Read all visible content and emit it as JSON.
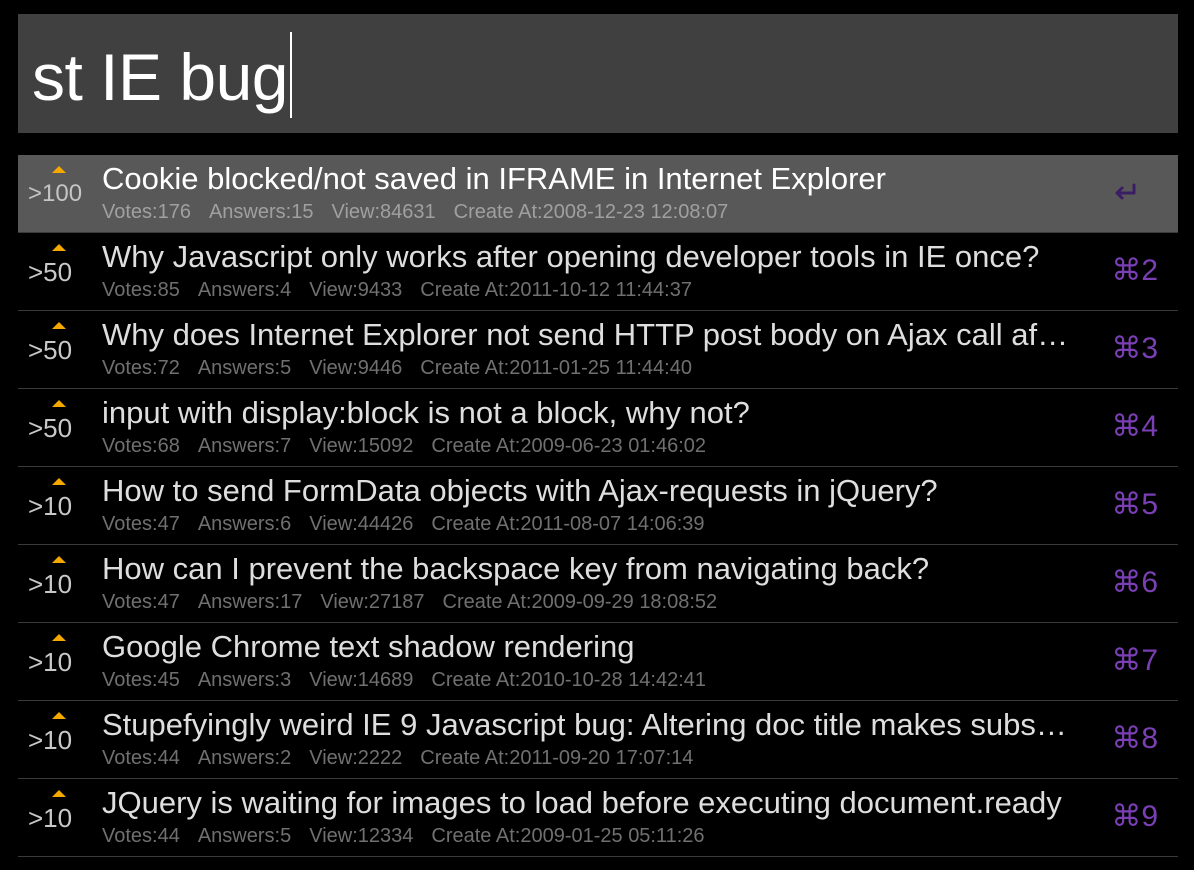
{
  "search": {
    "query": "st IE bug"
  },
  "colors": {
    "background": "#000000",
    "search_bg": "#404040",
    "selected_row_bg": "#585858",
    "shortcut_purple": "#7a3fb4",
    "score_arrow": "#f5a800"
  },
  "results": [
    {
      "score": ">100",
      "title": "Cookie blocked/not saved in IFRAME in Internet Explorer",
      "votes": "Votes:176",
      "answers": "Answers:15",
      "views": "View:84631",
      "created": "Create At:2008-12-23 12:08:07",
      "shortcut_icon": "return-icon",
      "selected": true
    },
    {
      "score": ">50",
      "title": "Why Javascript only works after opening developer tools in IE once?",
      "votes": "Votes:85",
      "answers": "Answers:4",
      "views": "View:9433",
      "created": "Create At:2011-10-12 11:44:37",
      "shortcut": "⌘2"
    },
    {
      "score": ">50",
      "title": "Why does Internet Explorer not send HTTP post body on Ajax call af…",
      "votes": "Votes:72",
      "answers": "Answers:5",
      "views": "View:9446",
      "created": "Create At:2011-01-25 11:44:40",
      "shortcut": "⌘3"
    },
    {
      "score": ">50",
      "title": "input with display:block is not a block, why not?",
      "votes": "Votes:68",
      "answers": "Answers:7",
      "views": "View:15092",
      "created": "Create At:2009-06-23 01:46:02",
      "shortcut": "⌘4"
    },
    {
      "score": ">10",
      "title": "How to send FormData objects with Ajax-requests in jQuery?",
      "votes": "Votes:47",
      "answers": "Answers:6",
      "views": "View:44426",
      "created": "Create At:2011-08-07 14:06:39",
      "shortcut": "⌘5"
    },
    {
      "score": ">10",
      "title": "How can I prevent the backspace key from navigating back?",
      "votes": "Votes:47",
      "answers": "Answers:17",
      "views": "View:27187",
      "created": "Create At:2009-09-29 18:08:52",
      "shortcut": "⌘6"
    },
    {
      "score": ">10",
      "title": "Google Chrome text shadow rendering",
      "votes": "Votes:45",
      "answers": "Answers:3",
      "views": "View:14689",
      "created": "Create At:2010-10-28 14:42:41",
      "shortcut": "⌘7"
    },
    {
      "score": ">10",
      "title": "Stupefyingly weird IE 9 Javascript bug: Altering doc title makes subs…",
      "votes": "Votes:44",
      "answers": "Answers:2",
      "views": "View:2222",
      "created": "Create At:2011-09-20 17:07:14",
      "shortcut": "⌘8"
    },
    {
      "score": ">10",
      "title": "JQuery is waiting for images to load before executing document.ready",
      "votes": "Votes:44",
      "answers": "Answers:5",
      "views": "View:12334",
      "created": "Create At:2009-01-25 05:11:26",
      "shortcut": "⌘9"
    }
  ]
}
